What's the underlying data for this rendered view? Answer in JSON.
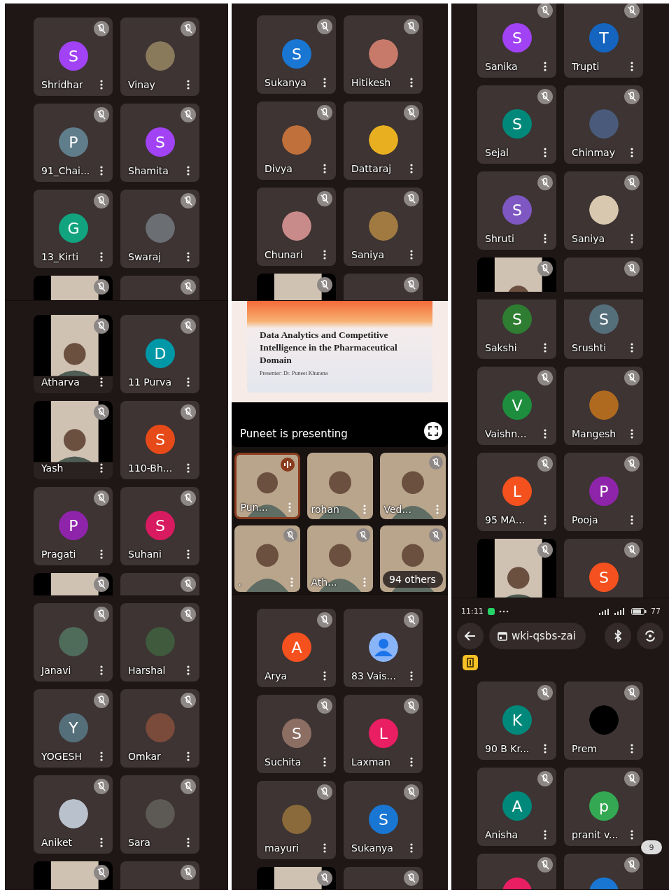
{
  "columns": [
    {
      "panels": [
        {
          "kind": "grid",
          "rows": [
            {
              "tiles": [
                {
                  "name": "Shridhar",
                  "kind": "letter",
                  "letter": "S",
                  "color": "#a142f4",
                  "muted": true
                },
                {
                  "name": "Vinay",
                  "kind": "photo",
                  "color": "#8a7a5c",
                  "muted": true
                }
              ]
            },
            {
              "tiles": [
                {
                  "name": "91_Chai...",
                  "kind": "letter",
                  "letter": "P",
                  "color": "#607d8b",
                  "muted": true
                },
                {
                  "name": "Shamita",
                  "kind": "letter",
                  "letter": "S",
                  "color": "#a142f4",
                  "muted": true
                }
              ]
            },
            {
              "tiles": [
                {
                  "name": "13_Kirti",
                  "kind": "letter",
                  "letter": "G",
                  "color": "#12a37f",
                  "muted": true
                },
                {
                  "name": "Swaraj",
                  "kind": "photo",
                  "color": "#6b6f74",
                  "muted": true
                }
              ]
            },
            {
              "tiles": [
                {
                  "kind": "video",
                  "muted": true
                },
                {
                  "kind": "empty",
                  "muted": true
                }
              ]
            }
          ]
        },
        {
          "kind": "grid",
          "rows": [
            {
              "tiles": [
                {
                  "name": "Atharva",
                  "kind": "video",
                  "muted": true
                },
                {
                  "name": "11 Purva",
                  "kind": "letter",
                  "letter": "D",
                  "color": "#0097a7",
                  "muted": true
                }
              ]
            },
            {
              "tiles": [
                {
                  "name": "Yash",
                  "kind": "video",
                  "muted": true
                },
                {
                  "name": "110-Bh...",
                  "kind": "letter",
                  "letter": "S",
                  "color": "#e64a19",
                  "muted": true
                }
              ]
            },
            {
              "tiles": [
                {
                  "name": "Pragati",
                  "kind": "letter",
                  "letter": "P",
                  "color": "#8e24aa",
                  "muted": true
                },
                {
                  "name": "Suhani",
                  "kind": "letter",
                  "letter": "S",
                  "color": "#d81b60",
                  "muted": true
                }
              ]
            },
            {
              "tiles": [
                {
                  "kind": "video",
                  "muted": true
                },
                {
                  "kind": "empty",
                  "muted": true
                }
              ]
            },
            {
              "tiles": [
                {
                  "name": "Janavi",
                  "kind": "photo",
                  "color": "#4f6b5a",
                  "muted": true
                },
                {
                  "name": "Harshal",
                  "kind": "photo",
                  "color": "#3f5a3c",
                  "muted": true
                }
              ]
            },
            {
              "tiles": [
                {
                  "name": "YOGESH",
                  "kind": "letter",
                  "letter": "Y",
                  "color": "#546e7a",
                  "muted": true
                },
                {
                  "name": "Omkar",
                  "kind": "photo",
                  "color": "#7a4a3a",
                  "muted": true
                }
              ]
            },
            {
              "tiles": [
                {
                  "name": "Aniket",
                  "kind": "photo",
                  "color": "#b9c2cc",
                  "muted": true
                },
                {
                  "name": "Sara",
                  "kind": "photo",
                  "color": "#5d5a55",
                  "muted": true
                }
              ]
            },
            {
              "tiles": [
                {
                  "kind": "video",
                  "muted": true
                },
                {
                  "kind": "empty",
                  "muted": true
                }
              ]
            }
          ]
        }
      ]
    },
    {
      "panels": [
        {
          "kind": "grid",
          "rows": [
            {
              "tiles": [
                {
                  "name": "Sukanya",
                  "kind": "letter",
                  "letter": "S",
                  "color": "#1976d2",
                  "muted": true
                },
                {
                  "name": "Hitikesh",
                  "kind": "photo",
                  "color": "#c77a6a",
                  "muted": true
                }
              ]
            },
            {
              "tiles": [
                {
                  "name": "Divya",
                  "kind": "photo",
                  "color": "#c0703a",
                  "muted": true
                },
                {
                  "name": "Dattaraj",
                  "kind": "photo",
                  "color": "#e8b020",
                  "muted": true
                }
              ]
            },
            {
              "tiles": [
                {
                  "name": "Chunari",
                  "kind": "photo",
                  "color": "#c98a8a",
                  "muted": true
                },
                {
                  "name": "Saniya",
                  "kind": "photo",
                  "color": "#a07a40",
                  "muted": true
                }
              ]
            },
            {
              "tiles": [
                {
                  "kind": "video",
                  "muted": true
                },
                {
                  "kind": "empty",
                  "muted": true
                }
              ]
            }
          ]
        },
        {
          "kind": "presentation",
          "slide": {
            "title": "Data Analytics and Competitive Intelligence in the Pharmaceutical Domain",
            "presenter": "Presenter: Dr. Puneet Khurana"
          },
          "caption": "Puneet is presenting",
          "tiles": [
            {
              "name": "Pun...",
              "kind": "video",
              "muted": false,
              "speaking": true
            },
            {
              "name": "rohan",
              "kind": "video",
              "muted": false,
              "speaking": false
            },
            {
              "name": "Ved...",
              "kind": "video",
              "muted": true,
              "speaking": false
            },
            {
              "name": ".",
              "kind": "video",
              "muted": true,
              "speaking": false
            },
            {
              "name": "Ath...",
              "kind": "video",
              "muted": true,
              "speaking": false
            },
            {
              "name": "94 others",
              "kind": "others",
              "muted": true,
              "speaking": false
            }
          ]
        },
        {
          "kind": "grid",
          "rows": [
            {
              "tiles": [
                {
                  "name": "Arya",
                  "kind": "letter",
                  "letter": "A",
                  "color": "#f4511e",
                  "muted": true
                },
                {
                  "name": "83 Vais...",
                  "kind": "default",
                  "muted": true
                }
              ]
            },
            {
              "tiles": [
                {
                  "name": "Suchita",
                  "kind": "letter",
                  "letter": "S",
                  "color": "#8d6e63",
                  "muted": true
                },
                {
                  "name": "Laxman",
                  "kind": "letter",
                  "letter": "L",
                  "color": "#e91e63",
                  "muted": true
                }
              ]
            },
            {
              "tiles": [
                {
                  "name": "mayuri",
                  "kind": "photo",
                  "color": "#8a6a3a",
                  "muted": true
                },
                {
                  "name": "Sukanya",
                  "kind": "letter",
                  "letter": "S",
                  "color": "#1976d2",
                  "muted": true
                }
              ]
            },
            {
              "tiles": [
                {
                  "kind": "video",
                  "muted": true
                },
                {
                  "kind": "empty",
                  "muted": true
                }
              ]
            }
          ]
        }
      ]
    },
    {
      "panels": [
        {
          "kind": "grid",
          "rows": [
            {
              "tiles": [
                {
                  "name": "Sanika",
                  "kind": "letter",
                  "letter": "S",
                  "color": "#a142f4",
                  "muted": true
                },
                {
                  "name": "Trupti",
                  "kind": "letter",
                  "letter": "T",
                  "color": "#1565c0",
                  "muted": true
                }
              ]
            },
            {
              "tiles": [
                {
                  "name": "Sejal",
                  "kind": "letter",
                  "letter": "S",
                  "color": "#00897b",
                  "muted": true
                },
                {
                  "name": "Chinmay",
                  "kind": "photo",
                  "color": "#4a5a7a",
                  "muted": true
                }
              ]
            },
            {
              "tiles": [
                {
                  "name": "Shruti",
                  "kind": "letter",
                  "letter": "S",
                  "color": "#7e57c2",
                  "muted": true
                },
                {
                  "name": "Saniya",
                  "kind": "photo",
                  "color": "#d8c8b0",
                  "muted": true
                }
              ]
            },
            {
              "tiles": [
                {
                  "kind": "video",
                  "muted": true
                },
                {
                  "kind": "empty",
                  "muted": true
                }
              ]
            },
            {
              "tiles": [
                {
                  "name": "Sakshi",
                  "kind": "letter",
                  "letter": "S",
                  "color": "#2e7d32"
                },
                {
                  "name": "Srushti",
                  "kind": "letter",
                  "letter": "S",
                  "color": "#546e7a"
                }
              ]
            },
            {
              "tiles": [
                {
                  "name": "Vaishn...",
                  "kind": "letter",
                  "letter": "V",
                  "color": "#1e8e3e",
                  "muted": true
                },
                {
                  "name": "Mangesh",
                  "kind": "photo",
                  "color": "#b06a20",
                  "muted": true
                }
              ]
            },
            {
              "tiles": [
                {
                  "name": "95 MA...",
                  "kind": "letter",
                  "letter": "L",
                  "color": "#f4511e",
                  "muted": true
                },
                {
                  "name": "Pooja",
                  "kind": "letter",
                  "letter": "P",
                  "color": "#8e24aa",
                  "muted": true
                }
              ]
            },
            {
              "tiles": [
                {
                  "kind": "video",
                  "muted": true
                },
                {
                  "kind": "letter",
                  "letter": "S",
                  "color": "#f4511e",
                  "muted": true
                }
              ]
            }
          ]
        },
        {
          "kind": "phone",
          "status": {
            "time": "11:11",
            "battery": "77"
          },
          "meeting_code": "wki-qsbs-zai",
          "badge": "9",
          "rows": [
            {
              "tiles": [
                {
                  "name": "90 B Kr...",
                  "kind": "letter",
                  "letter": "K",
                  "color": "#00897b",
                  "muted": true
                },
                {
                  "name": "Prem",
                  "kind": "photo",
                  "color": "#000000",
                  "muted": true
                }
              ]
            },
            {
              "tiles": [
                {
                  "name": "Anisha",
                  "kind": "letter",
                  "letter": "A",
                  "color": "#00897b",
                  "muted": true
                },
                {
                  "name": "pranit v...",
                  "kind": "letter",
                  "letter": "p",
                  "color": "#34a853",
                  "muted": true
                }
              ]
            },
            {
              "tiles": [
                {
                  "kind": "photo",
                  "color": "#e91e63",
                  "muted": true
                },
                {
                  "kind": "photo",
                  "color": "#1976d2",
                  "muted": true
                }
              ]
            }
          ]
        }
      ]
    }
  ]
}
